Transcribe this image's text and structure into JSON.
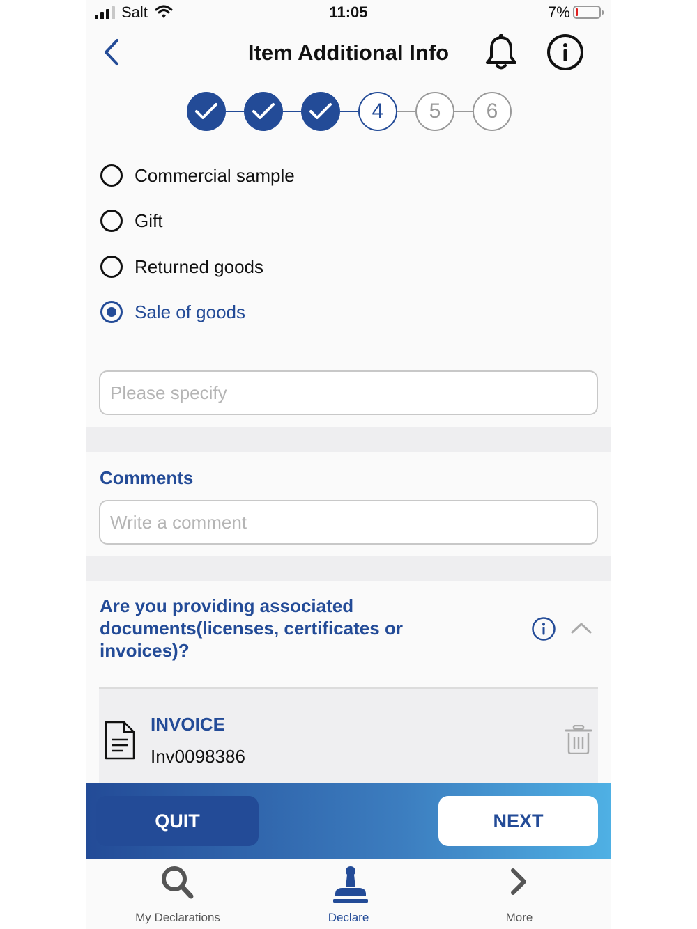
{
  "status_bar": {
    "carrier": "Salt",
    "time": "11:05",
    "battery": "7%"
  },
  "header": {
    "title": "Item Additional Info"
  },
  "stepper": {
    "steps": [
      "1",
      "2",
      "3",
      "4",
      "5",
      "6"
    ],
    "completed_count": 3,
    "current": "4"
  },
  "options": [
    {
      "label": "Commercial sample",
      "selected": false
    },
    {
      "label": "Gift",
      "selected": false
    },
    {
      "label": "Returned goods",
      "selected": false
    },
    {
      "label": "Sale of goods",
      "selected": true
    }
  ],
  "specify": {
    "placeholder": "Please specify",
    "value": ""
  },
  "comments": {
    "title": "Comments",
    "placeholder": "Write a comment",
    "value": ""
  },
  "documents": {
    "question": "Are you providing associated documents(licenses, certificates or invoices)?",
    "items": [
      {
        "type": "INVOICE",
        "number": "Inv0098386"
      }
    ]
  },
  "actions": {
    "quit": "QUIT",
    "next": "NEXT"
  },
  "tabs": [
    {
      "label": "My Declarations",
      "icon": "search-icon"
    },
    {
      "label": "Declare",
      "icon": "stamp-icon",
      "active": true
    },
    {
      "label": "More",
      "icon": "chevron-right-icon"
    }
  ],
  "colors": {
    "primary": "#234b97",
    "gradient_end": "#4fb0e4",
    "battery_low": "#e02020"
  }
}
